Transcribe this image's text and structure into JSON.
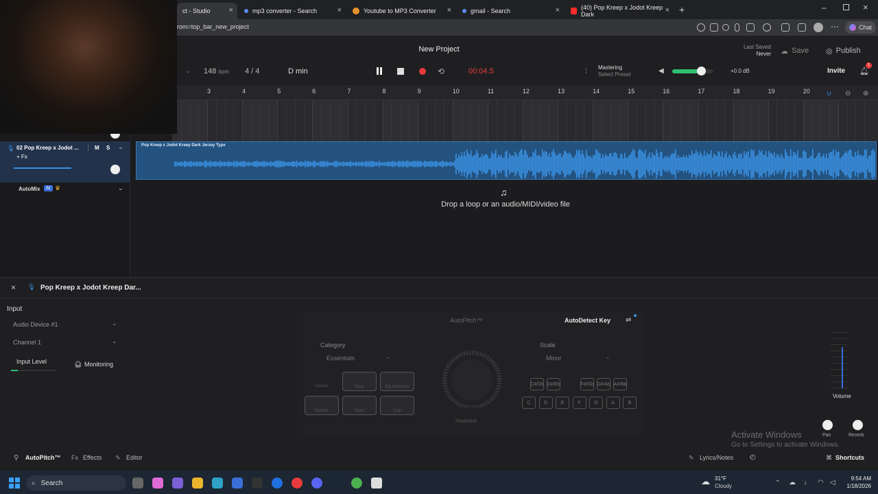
{
  "browser": {
    "tabs": [
      {
        "title": "ct - Studio",
        "color": "#888"
      },
      {
        "title": "mp3 converter - Search",
        "color": "#5b8cff"
      },
      {
        "title": "Youtube to MP3 Converter",
        "color": "#e8912d"
      },
      {
        "title": "gmail - Search",
        "color": "#5b8cff"
      },
      {
        "title": "(40) Pop Kreep x Jodot Kreep Dark",
        "color": "#ff2a2a"
      }
    ],
    "url": "rom=top_bar_new_project",
    "chat_label": "Chat"
  },
  "header": {
    "project_title": "New Project",
    "last_saved_label": "Last Saved",
    "last_saved_value": "Never",
    "save_label": "Save",
    "publish_label": "Publish",
    "bpm": "148",
    "bpm_unit": "bpm",
    "time_sig": "4 / 4",
    "key": "D min",
    "time": "00:04.5",
    "mastering_label": "Mastering",
    "mastering_preset": "Select Preset",
    "gain": "+0.0 dB",
    "invite_label": "Invite",
    "notif_count": "1"
  },
  "ruler": [
    "3",
    "4",
    "5",
    "6",
    "7",
    "8",
    "9",
    "10",
    "11",
    "12",
    "13",
    "14",
    "15",
    "16",
    "17",
    "18",
    "19",
    "20"
  ],
  "track": {
    "name": "02  Pop Kreep x Jodot ...",
    "fx": "+ Fx",
    "mute": "M",
    "solo": "S",
    "clip_title": "Pop Kreep x Jodot Kreep Dark Jersey Type"
  },
  "automix": {
    "label": "AutoMix",
    "badge": "AI"
  },
  "drop_text": "Drop a loop or an audio/MIDI/video file",
  "panel": {
    "title": "Pop Kreep x Jodot Kreep Dar...",
    "input_label": "Input",
    "device": "Audio Device #1",
    "channel": "Channel 1",
    "input_level": "Input Level",
    "monitoring": "Monitoring",
    "autopitch_title": "AutoPitch™",
    "autodetect": "AutoDetect Key",
    "category_label": "Category",
    "category_value": "Essentials",
    "scale_label": "Scale",
    "scale_value": "Minor",
    "presets": [
      "Classic",
      "Duet",
      "Big Harmony",
      "Robotic",
      "Steel",
      "Chip"
    ],
    "heaviest": "Heaviest",
    "sharp_keys": [
      "C#/Db",
      "D#/Eb",
      "F#/Gb",
      "G#/Ab",
      "A#/Bb"
    ],
    "keys": [
      "C",
      "D",
      "E",
      "F",
      "G",
      "A",
      "B"
    ],
    "volume": "Volume",
    "pan": "Pan",
    "reverb": "Reverb",
    "watermark_title": "Activate Windows",
    "watermark_sub": "Go to Settings to activate Windows."
  },
  "footer": {
    "autopitch": "AutoPitch™",
    "effects": "Effects",
    "editor": "Editor",
    "lyrics": "Lyrics/Notes",
    "shortcuts": "Shortcuts"
  },
  "taskbar": {
    "search": "Search",
    "weather_temp": "31°F",
    "weather_desc": "Cloudy",
    "time": "9:54 AM",
    "date": "1/18/2026"
  },
  "colors": {
    "accent": "#e83b3b",
    "clip": "#3a8fe0",
    "green": "#2fbf6f"
  }
}
